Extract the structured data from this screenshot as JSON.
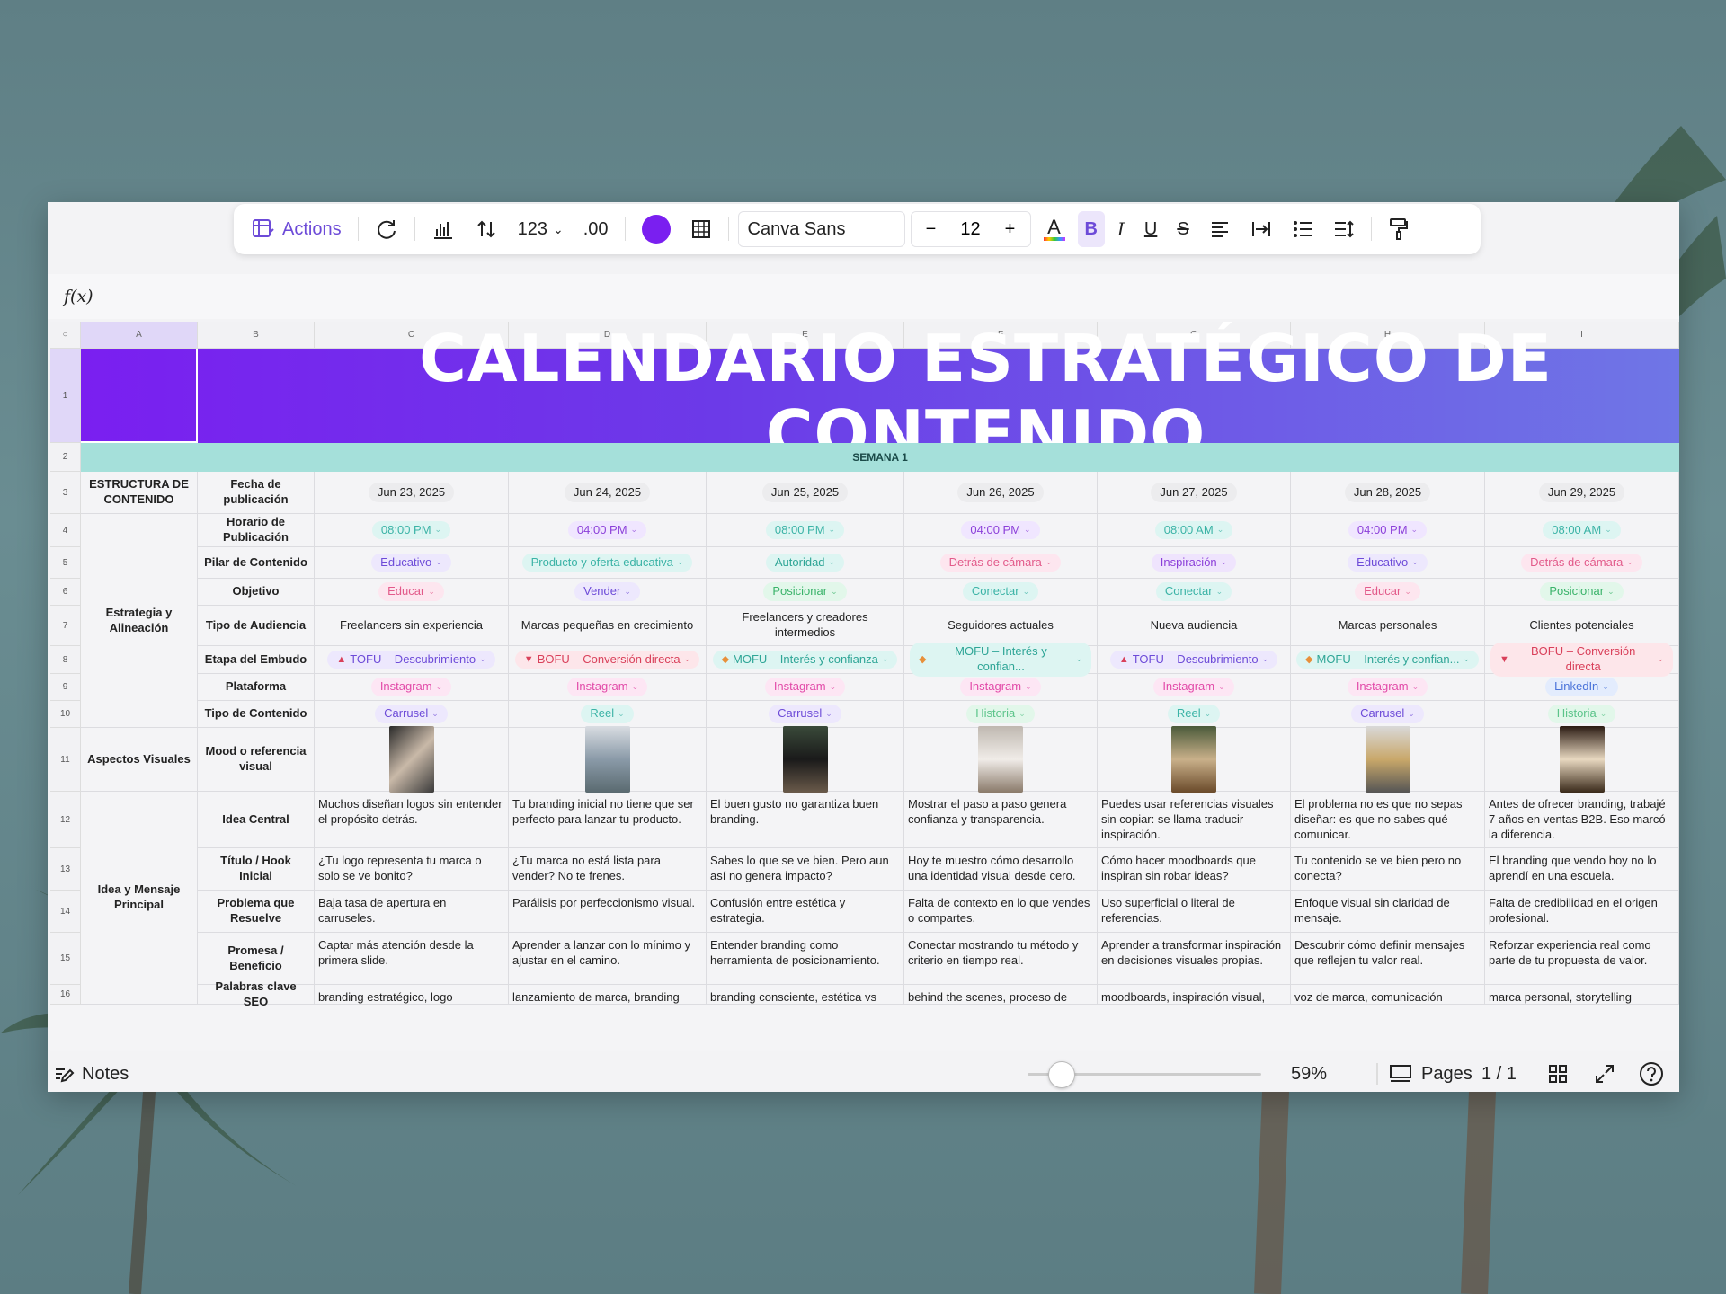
{
  "toolbar": {
    "actions": "Actions",
    "number_format": "123",
    "decimal": ".00",
    "font": "Canva Sans",
    "size_minus": "−",
    "font_size": "12",
    "size_plus": "+",
    "bold": "B",
    "italic": "I",
    "underline": "U",
    "strike": "S",
    "text_color": "A"
  },
  "formula": {
    "fx": "f(x)"
  },
  "colors": {
    "accent": "#6d4bd8",
    "fill_color": "#7a1ff0",
    "banner_start": "#7a1ff0",
    "banner_end": "#6f76e6",
    "week_band": "#a5e0da"
  },
  "sheet": {
    "corner": "○",
    "columns": [
      "A",
      "B",
      "C",
      "D",
      "E",
      "F",
      "G",
      "H",
      "I"
    ],
    "rows": [
      "1",
      "2",
      "3",
      "4",
      "5",
      "6",
      "7",
      "8",
      "9",
      "10",
      "11",
      "12",
      "13",
      "14",
      "15",
      "16"
    ],
    "title": "CALENDARIO ESTRATÉGICO DE CONTENIDO",
    "week": "SEMANA 1",
    "groups": {
      "estructura": "ESTRUCTURA DE CONTENIDO",
      "estrategia": "Estrategia y Alineación",
      "visual": "Aspectos Visuales",
      "idea": "Idea y Mensaje Principal"
    },
    "labels": {
      "fecha": "Fecha de publicación",
      "horario": "Horario de Publicación",
      "pilar": "Pilar de Contenido",
      "objetivo": "Objetivo",
      "audiencia": "Tipo de Audiencia",
      "embudo": "Etapa del Embudo",
      "plataforma": "Plataforma",
      "tipo": "Tipo de Contenido",
      "mood": "Mood o referencia visual",
      "idea": "Idea Central",
      "hook": "Título / Hook Inicial",
      "problema": "Problema que Resuelve",
      "promesa": "Promesa / Beneficio",
      "seo": "Palabras clave SEO"
    },
    "days": [
      {
        "date": "Jun 23, 2025",
        "time": "08:00 PM",
        "pilar": "Educativo",
        "objetivo": "Educar",
        "audiencia": "Freelancers sin experiencia",
        "embudo": "TOFU – Descubrimiento",
        "plataforma": "Instagram",
        "tipo": "Carrusel",
        "idea": "Muchos diseñan logos sin entender el propósito detrás.",
        "hook": "¿Tu logo representa tu marca o solo se ve bonito?",
        "problema": "Baja tasa de apertura en carruseles.",
        "promesa": "Captar más atención desde la primera slide.",
        "seo": "branding estratégico, logo"
      },
      {
        "date": "Jun 24, 2025",
        "time": "04:00 PM",
        "pilar": "Producto y oferta educativa",
        "objetivo": "Vender",
        "audiencia": "Marcas pequeñas en crecimiento",
        "embudo": "BOFU – Conversión directa",
        "plataforma": "Instagram",
        "tipo": "Reel",
        "idea": "Tu branding inicial no tiene que ser perfecto para lanzar tu producto.",
        "hook": "¿Tu marca no está lista para vender? No te frenes.",
        "problema": "Parálisis por perfeccionismo visual.",
        "promesa": "Aprender a lanzar con lo mínimo y ajustar en el camino.",
        "seo": "lanzamiento de marca, branding"
      },
      {
        "date": "Jun 25, 2025",
        "time": "08:00 PM",
        "pilar": "Autoridad",
        "objetivo": "Posicionar",
        "audiencia": "Freelancers y creadores intermedios",
        "embudo": "MOFU – Interés y confianza",
        "plataforma": "Instagram",
        "tipo": "Carrusel",
        "idea": "El buen gusto no garantiza buen branding.",
        "hook": "Sabes lo que se ve bien. Pero aun así no genera impacto?",
        "problema": "Confusión entre estética y estrategia.",
        "promesa": "Entender branding como herramienta de posicionamiento.",
        "seo": "branding consciente, estética vs"
      },
      {
        "date": "Jun 26, 2025",
        "time": "04:00 PM",
        "pilar": "Detrás de cámara",
        "objetivo": "Conectar",
        "audiencia": "Seguidores actuales",
        "embudo": "MOFU – Interés y confian...",
        "plataforma": "Instagram",
        "tipo": "Historia",
        "idea": "Mostrar el paso a paso genera confianza y transparencia.",
        "hook": "Hoy te muestro cómo desarrollo una identidad visual desde cero.",
        "problema": "Falta de contexto en lo que vendes o compartes.",
        "promesa": "Conectar mostrando tu método y criterio en tiempo real.",
        "seo": "behind the scenes, proceso de"
      },
      {
        "date": "Jun 27, 2025",
        "time": "08:00 AM",
        "pilar": "Inspiración",
        "objetivo": "Conectar",
        "audiencia": "Nueva audiencia",
        "embudo": "TOFU – Descubrimiento",
        "plataforma": "Instagram",
        "tipo": "Reel",
        "idea": "Puedes usar referencias visuales sin copiar: se llama traducir inspiración.",
        "hook": "Cómo hacer moodboards que inspiran sin robar ideas?",
        "problema": "Uso superficial o literal de referencias.",
        "promesa": "Aprender a transformar inspiración en decisiones visuales propias.",
        "seo": "moodboards, inspiración visual,"
      },
      {
        "date": "Jun 28, 2025",
        "time": "04:00 PM",
        "pilar": "Educativo",
        "objetivo": "Educar",
        "audiencia": "Marcas personales",
        "embudo": "MOFU – Interés y confian...",
        "plataforma": "Instagram",
        "tipo": "Carrusel",
        "idea": "El problema no es que no sepas diseñar: es que no sabes qué comunicar.",
        "hook": "Tu contenido se ve bien pero no conecta?",
        "problema": "Enfoque visual sin claridad de mensaje.",
        "promesa": "Descubrir cómo definir mensajes que reflejen tu valor real.",
        "seo": "voz de marca, comunicación"
      },
      {
        "date": "Jun 29, 2025",
        "time": "08:00 AM",
        "pilar": "Detrás de cámara",
        "objetivo": "Posicionar",
        "audiencia": "Clientes potenciales",
        "embudo": "BOFU – Conversión directa",
        "plataforma": "LinkedIn",
        "tipo": "Historia",
        "idea": "Antes de ofrecer branding, trabajé 7 años en ventas B2B. Eso marcó la diferencia.",
        "hook": "El branding que vendo hoy no lo aprendí en una escuela.",
        "problema": "Falta de credibilidad en el origen profesional.",
        "promesa": "Reforzar experiencia real como parte de tu propuesta de valor.",
        "seo": "marca personal, storytelling"
      }
    ]
  },
  "bottom": {
    "notes": "Notes",
    "zoom": "59%",
    "pages": "Pages",
    "page_count": "1 / 1"
  }
}
